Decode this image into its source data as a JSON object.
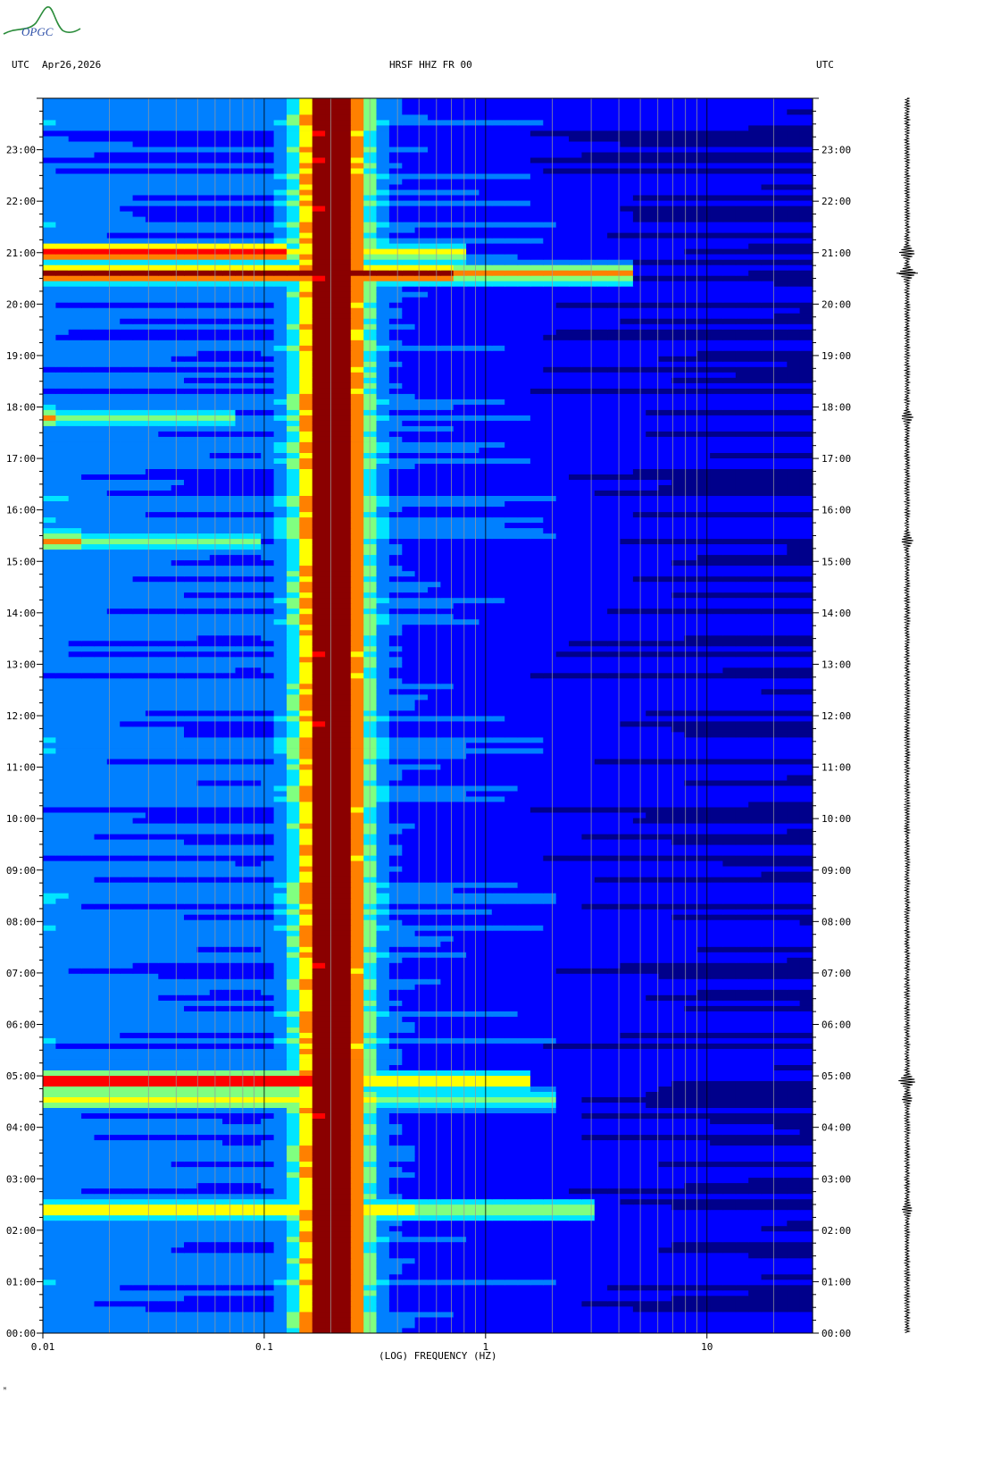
{
  "header": {
    "utc_left": "UTC",
    "date": "Apr26,2026",
    "title": "HRSF HHZ FR 00",
    "utc_right": "UTC"
  },
  "logo_text": "OPGC",
  "corner_mark": "ᴹ",
  "chart_data": {
    "type": "heatmap",
    "subtype": "spectrogram",
    "xlabel": "(LOG) FREQUENCY (HZ)",
    "x_scale": "log",
    "xlim_hz": [
      0.01,
      30
    ],
    "x_ticks": [
      {
        "value": 0.01,
        "label": "0.01"
      },
      {
        "value": 0.1,
        "label": "0.1"
      },
      {
        "value": 1,
        "label": "1"
      },
      {
        "value": 10,
        "label": "10"
      }
    ],
    "ylim_hours": [
      0,
      24
    ],
    "y_tick_labels": [
      "00:00",
      "01:00",
      "02:00",
      "03:00",
      "04:00",
      "05:00",
      "06:00",
      "07:00",
      "08:00",
      "09:00",
      "10:00",
      "11:00",
      "12:00",
      "13:00",
      "14:00",
      "15:00",
      "16:00",
      "17:00",
      "18:00",
      "19:00",
      "20:00",
      "21:00",
      "22:00",
      "23:00"
    ],
    "colormap": [
      "#00008b",
      "#0000ff",
      "#0080ff",
      "#00e5ff",
      "#80ff80",
      "#ffff00",
      "#ff8000",
      "#ff0000",
      "#8b0000"
    ],
    "background_color": "#1a1ab0",
    "microseism_band_hz": [
      0.14,
      0.3
    ],
    "events": [
      {
        "time_hours": 20.6,
        "max_freq_hz": 4.5,
        "level": 1.0
      },
      {
        "time_hours": 21.0,
        "max_freq_hz": 0.8,
        "level": 0.9
      },
      {
        "time_hours": 17.8,
        "max_freq_hz": 0.075,
        "level": 0.6
      },
      {
        "time_hours": 15.4,
        "max_freq_hz": 0.1,
        "level": 0.6
      },
      {
        "time_hours": 4.9,
        "max_freq_hz": 1.5,
        "level": 1.0
      },
      {
        "time_hours": 4.55,
        "max_freq_hz": 2.0,
        "level": 0.5
      },
      {
        "time_hours": 2.4,
        "max_freq_hz": 3.0,
        "level": 0.5
      }
    ]
  }
}
